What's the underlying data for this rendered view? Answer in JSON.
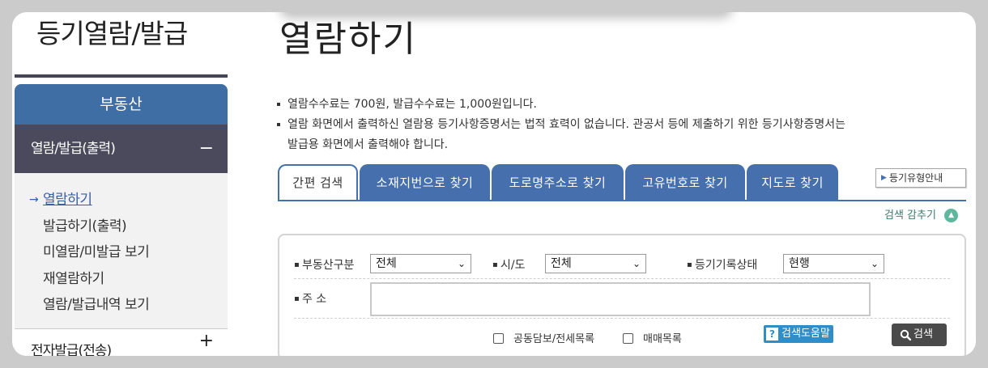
{
  "sidebar": {
    "title": "등기열람/발급",
    "category": "부동산",
    "section": "열람/발급(출력)",
    "section_toggle": "−",
    "items": [
      {
        "label": "열람하기",
        "active": true
      },
      {
        "label": "발급하기(출력)"
      },
      {
        "label": "미열람/미발급 보기"
      },
      {
        "label": "재열람하기"
      },
      {
        "label": "열람/발급내역 보기"
      }
    ],
    "next_section": "전자발급(전송)",
    "next_toggle": "+"
  },
  "main": {
    "title": "열람하기",
    "notices": [
      "열람수수료는 700원, 발급수수료는 1,000원입니다.",
      "열람 화면에서 출력하신 열람용 등기사항증명서는 법적 효력이 없습니다. 관공서 등에 제출하기 위한 등기사항증명서는",
      "발급용 화면에서 출력해야 합니다."
    ],
    "tabs": [
      "간편 검색",
      "소재지번으로 찾기",
      "도로명주소로 찾기",
      "고유번호로 찾기",
      "지도로 찾기"
    ],
    "active_tab": 0,
    "guide_button": "등기유형안내",
    "fold_label": "검색 감추기"
  },
  "search": {
    "property_type_label": "부동산구분",
    "property_type_value": "전체",
    "region_label": "시/도",
    "region_value": "전체",
    "status_label": "등기기록상태",
    "status_value": "현행",
    "address_label": "주 소",
    "address_value": "",
    "checkbox_joint": "공동담보/전세목록",
    "checkbox_trade": "매매목록",
    "help_button": "검색도움말",
    "search_button": "검색"
  },
  "colors": {
    "accent_blue": "#4570ad",
    "sidebar_dark": "#4a4a5c",
    "fold_green": "#5fb89e"
  }
}
